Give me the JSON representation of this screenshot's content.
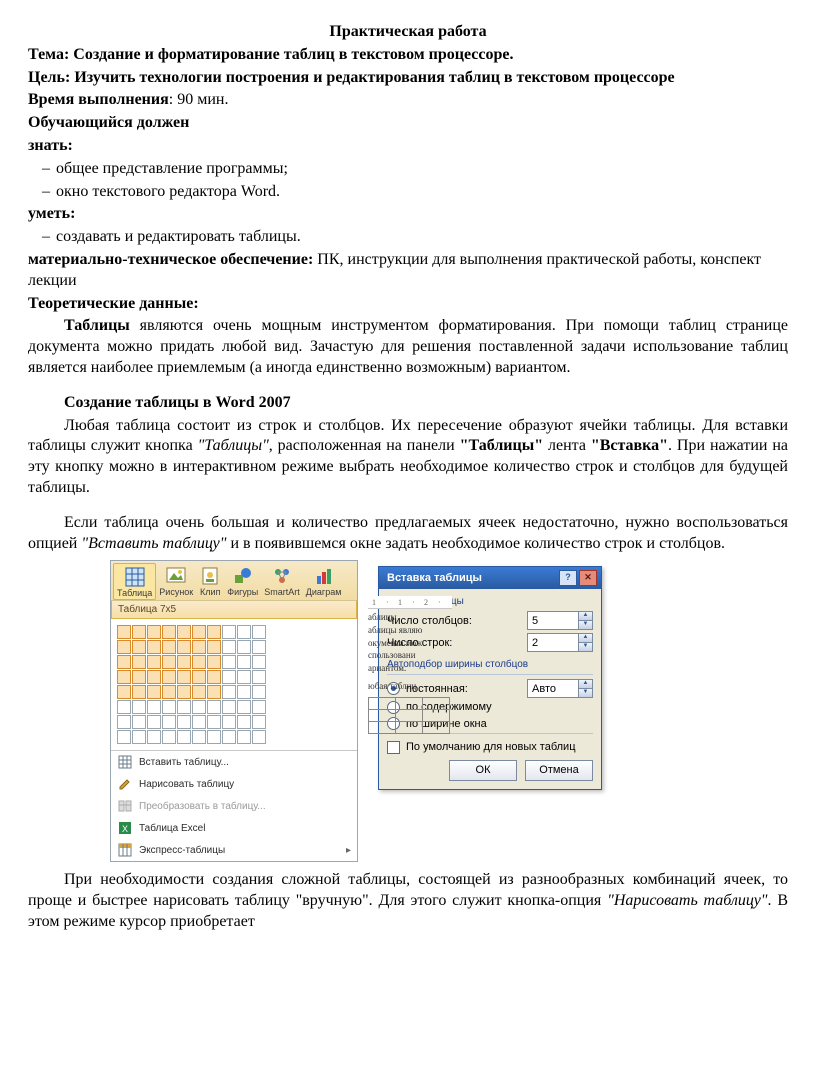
{
  "title": "Практическая работа",
  "topic_label": "Тема:",
  "topic": " Создание и форматирование таблиц в текстовом процессоре.",
  "goal_label": "Цель:",
  "goal": " Изучить технологии построения и редактирования таблиц в текстовом процессоре",
  "time_label": "Время выполнения",
  "time_value": ": 90 мин.",
  "student_must": "Обучающийся должен",
  "know_label": "знать:",
  "know_items": [
    "общее представление программы;",
    "окно текстового редактора Word."
  ],
  "can_label": "уметь:",
  "can_items": [
    "создавать и редактировать таблицы."
  ],
  "mat_label": "материально-техническое обеспечение:",
  "mat_value": " ПК, инструкции для выполнения практической работы, конспект лекции",
  "theory_label": "Теоретические данные:",
  "para1_lead": "Таблицы",
  "para1": " являются очень мощным инструментом форматирования. При помощи таблиц странице документа можно придать любой вид. Зачастую для решения поставленной задачи использование таблиц является наиболее приемлемым (а иногда единственно возможным) вариантом.",
  "section2": "Создание таблицы в Word 2007",
  "para2a": "Любая таблица состоит из строк и столбцов. Их пересечение образуют ячейки таблицы. Для вставки таблицы служит кнопка ",
  "para2b": "\"Таблицы\"",
  "para2c": ", расположенная на  панели ",
  "para2d": "\"Таблицы\"",
  "para2e": " лента ",
  "para2f": "\"Вставка\"",
  "para2g": ". При нажатии на эту кнопку можно в интерактивном режиме выбрать необходимое количество строк и столбцов для будущей таблицы.",
  "para3a": "Если таблица очень большая и количество предлагаемых ячеек недостаточно, нужно воспользоваться опцией ",
  "para3b": "\"Вставить таблицу\"",
  "para3c": " и в появившемся окне задать необходимое количество строк и столбцов.",
  "para4a": "При необходимости создания сложной таблицы, состоящей из разнообразных комбинаций ячеек, то проще и быстрее нарисовать таблицу \"вручную\". Для этого служит кнопка-опция ",
  "para4b": "\"Нарисовать таблицу\"",
  "para4c": ". В этом режиме курсор приобретает",
  "ribbon": {
    "buttons": [
      "Таблица",
      "Рисунок",
      "Клип",
      "Фигуры",
      "SmartArt",
      "Диаграм"
    ],
    "picker_header": "Таблица 7x5",
    "ruler_marks": [
      "1",
      "·",
      "1",
      "·",
      "2",
      "·"
    ],
    "preview_lines": [
      "аблицы",
      "аблицы являю",
      "окумента мож",
      "спользовани",
      "ариантом.",
      "юбая таблиц"
    ],
    "menu": [
      {
        "icon": "grid",
        "label": "Вставить таблицу...",
        "disabled": false
      },
      {
        "icon": "pencil",
        "label": "Нарисовать таблицу",
        "disabled": false
      },
      {
        "icon": "convert",
        "label": "Преобразовать в таблицу...",
        "disabled": true
      },
      {
        "icon": "excel",
        "label": "Таблица Excel",
        "disabled": false
      },
      {
        "icon": "quick",
        "label": "Экспресс-таблицы",
        "disabled": false
      }
    ]
  },
  "dialog": {
    "title": "Вставка таблицы",
    "grp_size": "Размер таблицы",
    "cols_label": "Число столбцов:",
    "cols_value": "5",
    "rows_label": "Число строк:",
    "rows_value": "2",
    "grp_auto": "Автоподбор ширины столбцов",
    "auto_opts": [
      {
        "label": "постоянная:",
        "checked": true,
        "value": "Авто"
      },
      {
        "label": "по содержимому",
        "checked": false
      },
      {
        "label": "по ширине окна",
        "checked": false
      }
    ],
    "remember": "По умолчанию для новых таблиц",
    "ok": "ОК",
    "cancel": "Отмена"
  }
}
